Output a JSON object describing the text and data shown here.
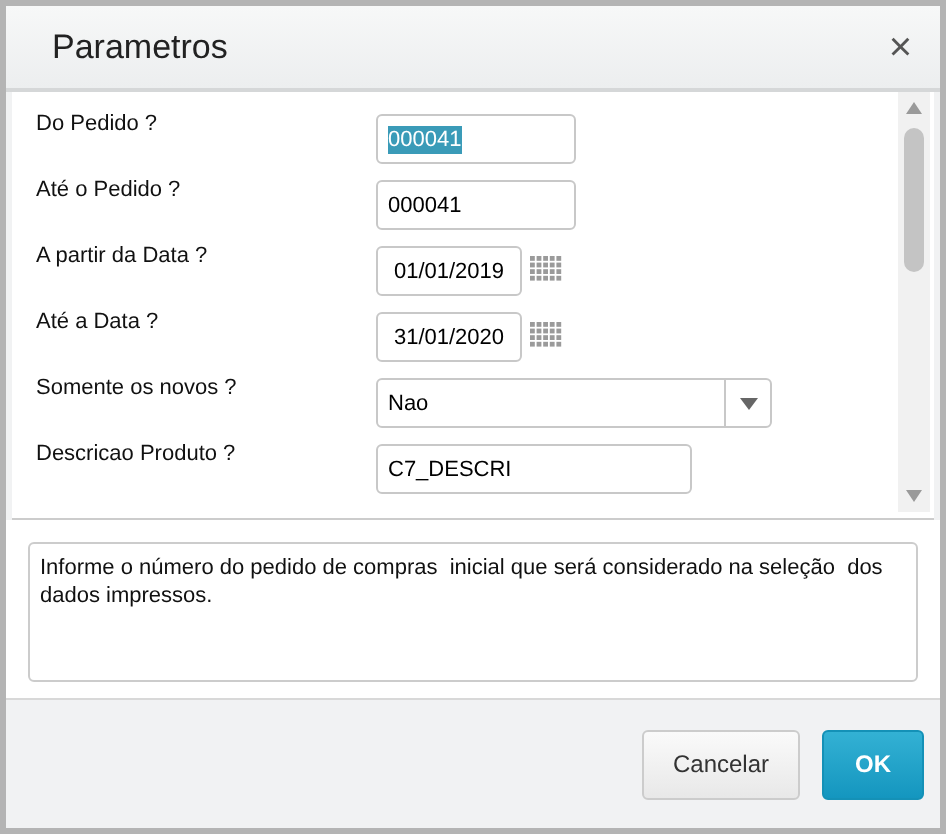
{
  "window": {
    "title": "Parametros",
    "close": "×"
  },
  "fields": [
    {
      "label": "Do Pedido ?",
      "kind": "text",
      "value": "000041",
      "selected": true
    },
    {
      "label": "Até o Pedido ?",
      "kind": "text",
      "value": "000041",
      "selected": false
    },
    {
      "label": "A partir da Data ?",
      "kind": "date",
      "value": "01/01/2019",
      "selected": false
    },
    {
      "label": "Até a Data ?",
      "kind": "date",
      "value": "31/01/2020",
      "selected": false
    },
    {
      "label": "Somente os novos ?",
      "kind": "select",
      "value": "Nao",
      "selected": false
    },
    {
      "label": "Descricao Produto ?",
      "kind": "wide",
      "value": "C7_DESCRI",
      "selected": false
    }
  ],
  "help": "Informe o número do pedido de compras  inicial que será considerado na seleção  dos dados impressos.",
  "buttons": [
    {
      "label": "Cancelar",
      "kind": "secondary"
    },
    {
      "label": "OK",
      "kind": "primary"
    }
  ]
}
